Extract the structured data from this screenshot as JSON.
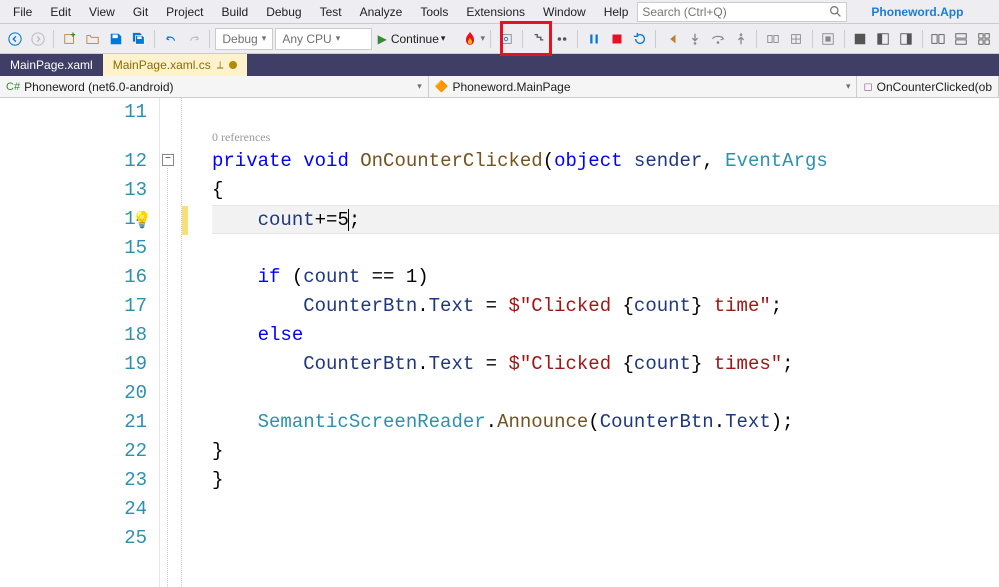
{
  "menubar": {
    "items": [
      "File",
      "Edit",
      "View",
      "Git",
      "Project",
      "Build",
      "Debug",
      "Test",
      "Analyze",
      "Tools",
      "Extensions",
      "Window",
      "Help"
    ],
    "search_placeholder": "Search (Ctrl+Q)",
    "project_name": "Phoneword.App"
  },
  "toolbar": {
    "config": "Debug",
    "platform": "Any CPU",
    "continue_label": "Continue"
  },
  "tabs": [
    {
      "label": "MainPage.xaml",
      "active": false
    },
    {
      "label": "MainPage.xaml.cs",
      "active": true
    }
  ],
  "nav": {
    "project": "Phoneword (net6.0-android)",
    "class": "Phoneword.MainPage",
    "member": "OnCounterClicked(ob"
  },
  "code": {
    "references_label": "0 references",
    "lines": [
      {
        "n": 11,
        "tokens": []
      },
      {
        "n": 12,
        "tokens": [
          [
            "kw",
            "private"
          ],
          [
            "sp",
            " "
          ],
          [
            "kw",
            "void"
          ],
          [
            "sp",
            " "
          ],
          [
            "method-decl",
            "OnCounterClicked"
          ],
          [
            "punct",
            "("
          ],
          [
            "kw",
            "object"
          ],
          [
            "sp",
            " "
          ],
          [
            "var",
            "sender"
          ],
          [
            "punct",
            ", "
          ],
          [
            "type",
            "EventArgs"
          ]
        ]
      },
      {
        "n": 13,
        "tokens": [
          [
            "punct",
            "{"
          ]
        ]
      },
      {
        "n": 14,
        "hl": true,
        "tokens": [
          [
            "sp",
            "    "
          ],
          [
            "var",
            "count"
          ],
          [
            "punct",
            "+="
          ],
          [
            "punct",
            "5"
          ],
          [
            "cursor",
            "|"
          ],
          [
            "punct",
            ";"
          ]
        ]
      },
      {
        "n": 15,
        "tokens": []
      },
      {
        "n": 16,
        "tokens": [
          [
            "sp",
            "    "
          ],
          [
            "kw",
            "if"
          ],
          [
            "sp",
            " "
          ],
          [
            "punct",
            "("
          ],
          [
            "var",
            "count"
          ],
          [
            "sp",
            " "
          ],
          [
            "punct",
            "== 1)"
          ]
        ]
      },
      {
        "n": 17,
        "tokens": [
          [
            "sp",
            "        "
          ],
          [
            "var",
            "CounterBtn"
          ],
          [
            "punct",
            "."
          ],
          [
            "var",
            "Text"
          ],
          [
            "sp",
            " "
          ],
          [
            "punct",
            "= "
          ],
          [
            "str",
            "$\"Clicked "
          ],
          [
            "punct",
            "{"
          ],
          [
            "var",
            "count"
          ],
          [
            "punct",
            "}"
          ],
          [
            "str",
            " time\""
          ],
          [
            "punct",
            ";"
          ]
        ]
      },
      {
        "n": 18,
        "tokens": [
          [
            "sp",
            "    "
          ],
          [
            "kw",
            "else"
          ]
        ]
      },
      {
        "n": 19,
        "tokens": [
          [
            "sp",
            "        "
          ],
          [
            "var",
            "CounterBtn"
          ],
          [
            "punct",
            "."
          ],
          [
            "var",
            "Text"
          ],
          [
            "sp",
            " "
          ],
          [
            "punct",
            "= "
          ],
          [
            "str",
            "$\"Clicked "
          ],
          [
            "punct",
            "{"
          ],
          [
            "var",
            "count"
          ],
          [
            "punct",
            "}"
          ],
          [
            "str",
            " times\""
          ],
          [
            "punct",
            ";"
          ]
        ]
      },
      {
        "n": 20,
        "tokens": []
      },
      {
        "n": 21,
        "tokens": [
          [
            "sp",
            "    "
          ],
          [
            "class-ref",
            "SemanticScreenReader"
          ],
          [
            "punct",
            "."
          ],
          [
            "method-call",
            "Announce"
          ],
          [
            "punct",
            "("
          ],
          [
            "var",
            "CounterBtn"
          ],
          [
            "punct",
            "."
          ],
          [
            "var",
            "Text"
          ],
          [
            "punct",
            ");"
          ]
        ]
      },
      {
        "n": 22,
        "tokens": [
          [
            "punct",
            "}"
          ]
        ]
      },
      {
        "n": 23,
        "tokens": [
          [
            "punct",
            "}"
          ]
        ],
        "dedent": true
      },
      {
        "n": 24,
        "tokens": []
      },
      {
        "n": 25,
        "tokens": []
      }
    ]
  }
}
